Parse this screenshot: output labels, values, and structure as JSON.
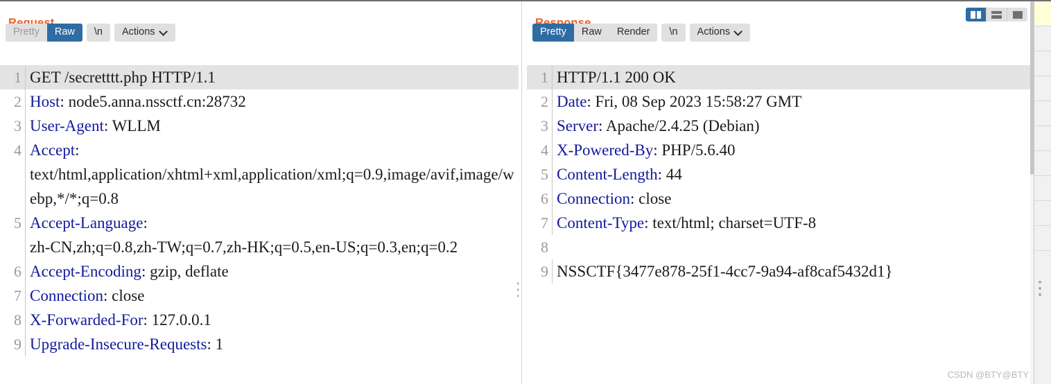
{
  "layout_toggle": {
    "buttons": [
      {
        "name": "split-vertical",
        "icon": "split-vertical-icon",
        "active": true
      },
      {
        "name": "split-horizontal",
        "icon": "split-horizontal-icon",
        "active": false
      },
      {
        "name": "single-pane",
        "icon": "single-pane-icon",
        "active": false
      }
    ]
  },
  "request": {
    "title": "Request",
    "tabs": [
      {
        "label": "Pretty",
        "state": "disabled"
      },
      {
        "label": "Raw",
        "state": "active"
      }
    ],
    "newline_button": "\\n",
    "actions_button": "Actions",
    "lines": [
      {
        "num": "1",
        "highlight": true,
        "header": "",
        "value": "GET /secretttt.php HTTP/1.1"
      },
      {
        "num": "2",
        "highlight": false,
        "header": "Host",
        "value": ": node5.anna.nssctf.cn:28732"
      },
      {
        "num": "3",
        "highlight": false,
        "header": "User-Agent",
        "value": ": WLLM"
      },
      {
        "num": "4",
        "highlight": false,
        "header": "Accept",
        "value": ":\ntext/html,application/xhtml+xml,application/xml;q=0.9,image/avif,image/webp,*/*;q=0.8"
      },
      {
        "num": "5",
        "highlight": false,
        "header": "Accept-Language",
        "value": ":\nzh-CN,zh;q=0.8,zh-TW;q=0.7,zh-HK;q=0.5,en-US;q=0.3,en;q=0.2"
      },
      {
        "num": "6",
        "highlight": false,
        "header": "Accept-Encoding",
        "value": ": gzip, deflate"
      },
      {
        "num": "7",
        "highlight": false,
        "header": "Connection",
        "value": ": close"
      },
      {
        "num": "8",
        "highlight": false,
        "header": "X-Forwarded-For",
        "value": ": 127.0.0.1"
      },
      {
        "num": "9",
        "highlight": false,
        "header": "Upgrade-Insecure-Requests",
        "value": ": 1"
      }
    ]
  },
  "response": {
    "title": "Response",
    "tabs": [
      {
        "label": "Pretty",
        "state": "active"
      },
      {
        "label": "Raw",
        "state": "normal"
      },
      {
        "label": "Render",
        "state": "normal"
      }
    ],
    "newline_button": "\\n",
    "actions_button": "Actions",
    "lines": [
      {
        "num": "1",
        "highlight": true,
        "header": "",
        "value": "HTTP/1.1 200 OK"
      },
      {
        "num": "2",
        "highlight": false,
        "header": "Date",
        "value": ": Fri, 08 Sep 2023 15:58:27 GMT"
      },
      {
        "num": "3",
        "highlight": false,
        "header": "Server",
        "value": ": Apache/2.4.25 (Debian)"
      },
      {
        "num": "4",
        "highlight": false,
        "header": "X-Powered-By",
        "value": ": PHP/5.6.40"
      },
      {
        "num": "5",
        "highlight": false,
        "header": "Content-Length",
        "value": ": 44"
      },
      {
        "num": "6",
        "highlight": false,
        "header": "Connection",
        "value": ": close"
      },
      {
        "num": "7",
        "highlight": false,
        "header": "Content-Type",
        "value": ": text/html; charset=UTF-8"
      },
      {
        "num": "8",
        "highlight": false,
        "header": "",
        "value": ""
      },
      {
        "num": "9",
        "highlight": false,
        "header": "",
        "value": "NSSCTF{3477e878-25f1-4cc7-9a94-af8caf5432d1}"
      }
    ]
  },
  "watermark": "CSDN @BTY@BTY",
  "colors": {
    "accent_title": "#e8622a",
    "tab_active": "#2f6ca3",
    "header_name": "#12199c",
    "line_number": "#9a9a9a",
    "highlight_row": "#e3e3e3"
  }
}
